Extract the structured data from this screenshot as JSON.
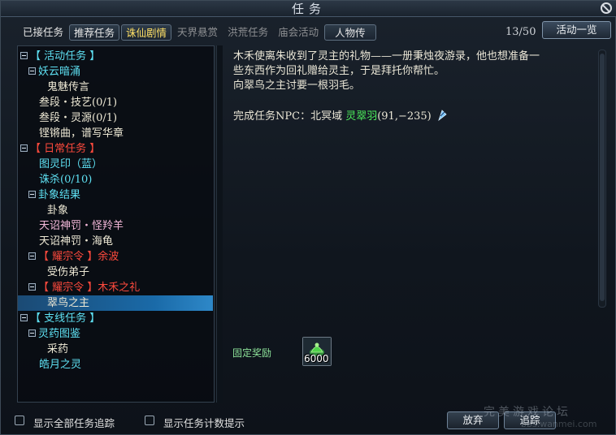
{
  "window": {
    "title": "任务"
  },
  "tabs": [
    {
      "label": "已接任务",
      "state": "normal"
    },
    {
      "label": "推荐任务",
      "state": "boxed"
    },
    {
      "label": "诛仙剧情",
      "state": "active"
    },
    {
      "label": "天界悬赏",
      "state": "dim"
    },
    {
      "label": "洪荒任务",
      "state": "dim"
    },
    {
      "label": "庙会活动",
      "state": "dim"
    },
    {
      "label": "人物传",
      "state": "people"
    }
  ],
  "quest_count": "13/50",
  "activity_button": "活动一览",
  "tree": [
    {
      "text": "【 活动任务 】",
      "level": 0,
      "toggle": true,
      "color": "cyan"
    },
    {
      "text": "妖云暗涌",
      "level": 1,
      "toggle": true,
      "color": "cyan"
    },
    {
      "text": "鬼魅传言",
      "level": 2,
      "toggle": false,
      "color": "white"
    },
    {
      "text": "叁段・技艺(0/1)",
      "level": 1,
      "toggle": false,
      "color": "white"
    },
    {
      "text": "叁段・灵源(0/1)",
      "level": 1,
      "toggle": false,
      "color": "white"
    },
    {
      "text": "铿锵曲，谱写华章",
      "level": 1,
      "toggle": false,
      "color": "white"
    },
    {
      "text": "【 日常任务 】",
      "level": 0,
      "toggle": true,
      "color": "red"
    },
    {
      "text": "图灵印（蓝）",
      "level": 1,
      "toggle": false,
      "color": "cyan"
    },
    {
      "text": "诛杀(0/10)",
      "level": 1,
      "toggle": false,
      "color": "cyan"
    },
    {
      "text": "卦象结果",
      "level": 1,
      "toggle": true,
      "color": "cyan"
    },
    {
      "text": "卦象",
      "level": 2,
      "toggle": false,
      "color": "white"
    },
    {
      "text": "天诏神罚・怪羚羊",
      "level": 1,
      "toggle": false,
      "color": "pink"
    },
    {
      "text": "天诏神罚・海龟",
      "level": 1,
      "toggle": false,
      "color": "white"
    },
    {
      "text": "【 耀宗令 】余波",
      "level": 1,
      "toggle": true,
      "color": "red"
    },
    {
      "text": "受伤弟子",
      "level": 2,
      "toggle": false,
      "color": "white"
    },
    {
      "text": "【 耀宗令 】木禾之礼",
      "level": 1,
      "toggle": true,
      "color": "red"
    },
    {
      "text": "翠鸟之主",
      "level": 2,
      "toggle": false,
      "color": "white",
      "selected": true
    },
    {
      "text": "【 支线任务 】",
      "level": 0,
      "toggle": true,
      "color": "cyan"
    },
    {
      "text": "灵药图鉴",
      "level": 1,
      "toggle": true,
      "color": "cyan"
    },
    {
      "text": "采药",
      "level": 2,
      "toggle": false,
      "color": "white"
    },
    {
      "text": "皓月之灵",
      "level": 1,
      "toggle": false,
      "color": "cyan"
    }
  ],
  "detail": {
    "lines": [
      "木禾使离朱收到了灵主的礼物——一册秉烛夜游录，他也想准备一",
      "些东西作为回礼赠给灵主，于是拜托你帮忙。",
      "向翠鸟之主讨要一根羽毛。"
    ],
    "npc_prefix": "完成任务NPC：北冥域 ",
    "npc_name": "灵翠羽",
    "npc_coords": "(91,−235)",
    "pin_icon": "navigate-pin-icon"
  },
  "reward": {
    "label": "固定奖励",
    "count": "6000",
    "icon": "reward-item-icon"
  },
  "bottom": {
    "track_all_label": "显示全部任务追踪",
    "count_hint_label": "显示任务计数提示",
    "abandon_label": "放弃",
    "track_label": "追踪"
  },
  "watermark": {
    "text": "完美游戏论坛",
    "url": "bbs.wanmei.com"
  },
  "colors": {
    "cyan": "#5ee0f2",
    "white": "#ede8d4",
    "red": "#ff4a3d",
    "pink": "#f3b8d9",
    "npc_green": "#4cea5a",
    "selection": "#1a6aa8"
  }
}
